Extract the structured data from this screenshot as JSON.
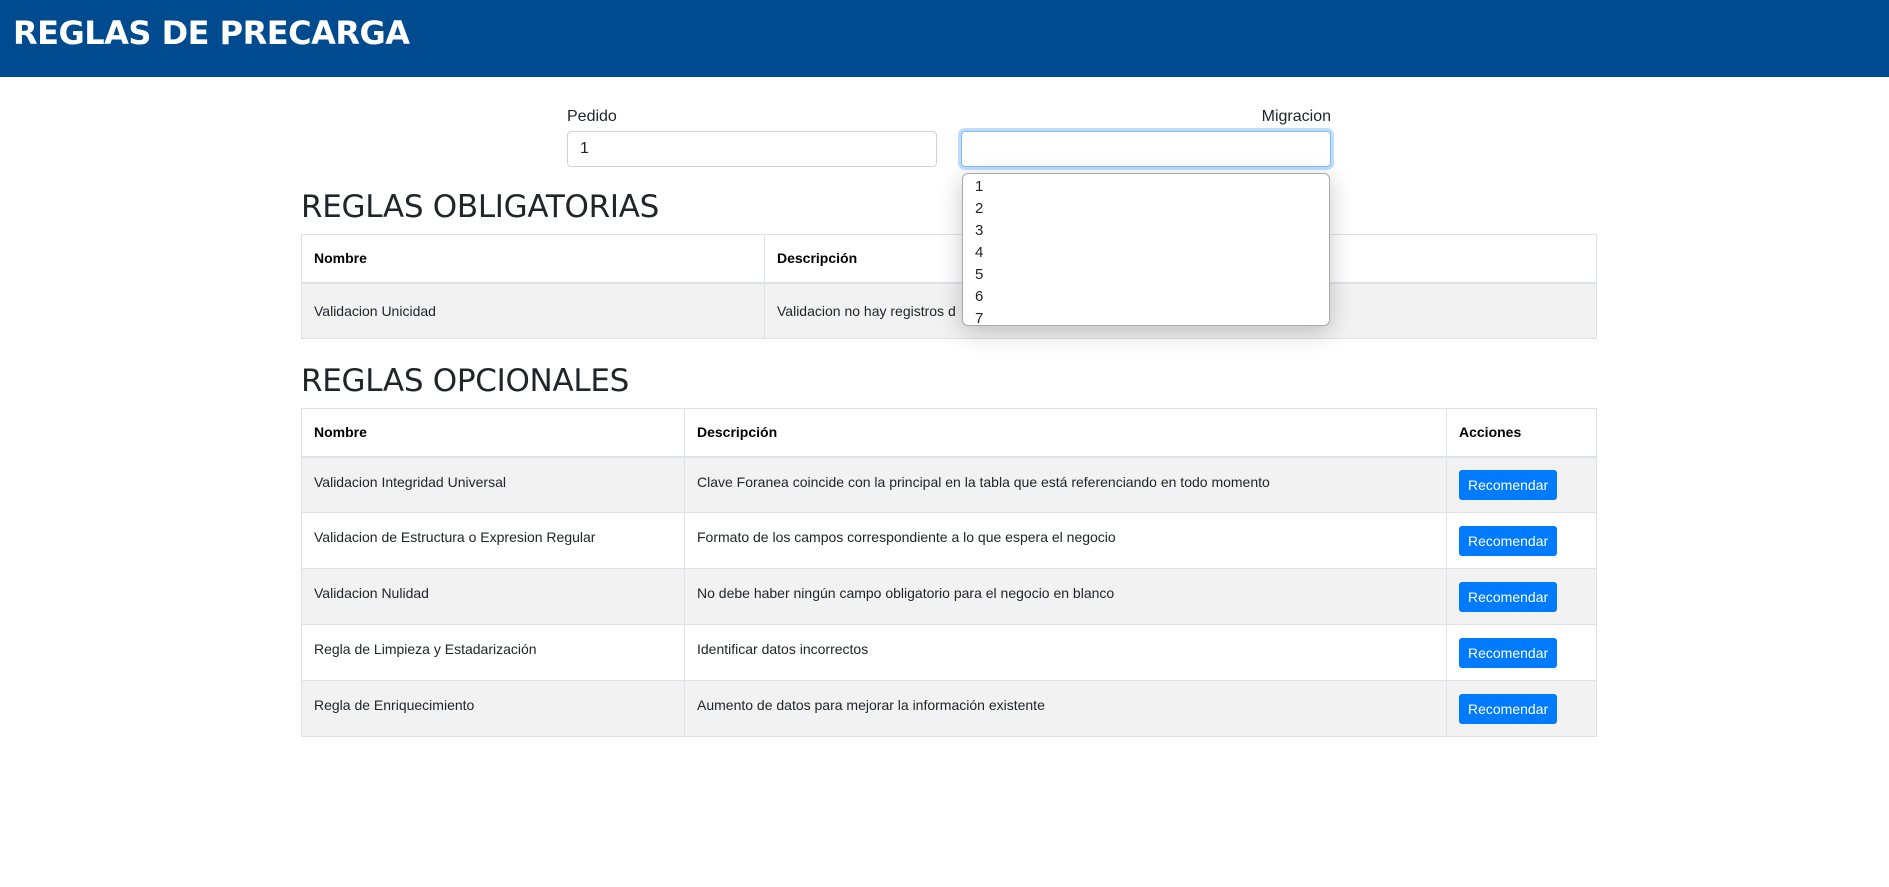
{
  "header": {
    "title": "REGLAS DE PRECARGA"
  },
  "pedido": {
    "label": "Pedido",
    "value": "1"
  },
  "migracion": {
    "label": "Migracion",
    "value": ""
  },
  "dropdown": {
    "options": [
      "1",
      "2",
      "3",
      "4",
      "5",
      "6",
      "7"
    ]
  },
  "obligatorias": {
    "title": "REGLAS OBLIGATORIAS",
    "columns": [
      "Nombre",
      "Descripción"
    ],
    "rows": [
      {
        "nombre": "Validacion Unicidad",
        "descripcion": "Validacion no hay registros d"
      }
    ]
  },
  "opcionales": {
    "title": "REGLAS OPCIONALES",
    "columns": [
      "Nombre",
      "Descripción",
      "Acciones"
    ],
    "action_label": "Recomendar",
    "rows": [
      {
        "nombre": "Validacion Integridad Universal",
        "descripcion": "Clave Foranea coincide con la principal en la tabla que está referenciando en todo momento"
      },
      {
        "nombre": "Validacion de Estructura o Expresion Regular",
        "descripcion": "Formato de los campos correspondiente a lo que espera el negocio"
      },
      {
        "nombre": "Validacion Nulidad",
        "descripcion": "No debe haber ningún campo obligatorio para el negocio en blanco"
      },
      {
        "nombre": "Regla de Limpieza y Estadarización",
        "descripcion": "Identificar datos incorrectos"
      },
      {
        "nombre": "Regla de Enriquecimiento",
        "descripcion": "Aumento de datos para mejorar la información existente"
      }
    ]
  },
  "colors": {
    "header_bg": "#004b8f",
    "button_bg": "#007bff",
    "stripe_bg": "#f2f2f2"
  }
}
